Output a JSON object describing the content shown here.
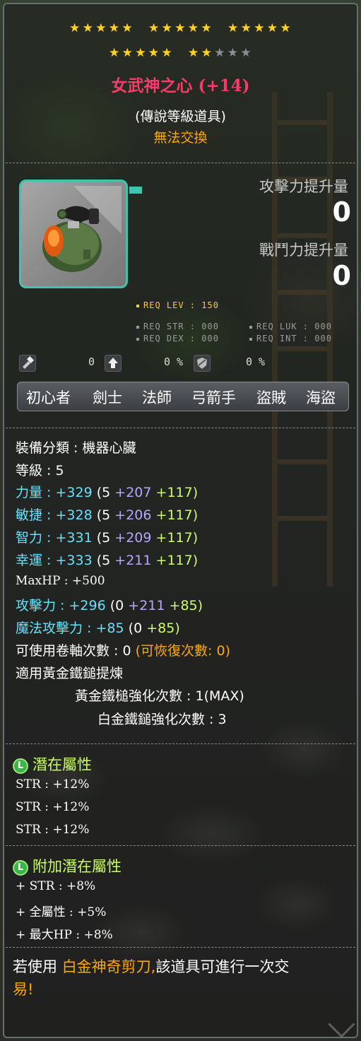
{
  "stars": {
    "top_row_filled": 15,
    "second_row_filled": 7,
    "second_row_total": 10
  },
  "item": {
    "name": "女武神之心 (+14)",
    "grade": "(傳說等級道具)",
    "trade_status": "無法交換"
  },
  "compare": {
    "attack_label": "攻擊力提升量",
    "attack_value": "0",
    "combat_label": "戰鬥力提升量",
    "combat_value": "0"
  },
  "requirements": {
    "level": "REQ LEV : 150",
    "str": "REQ STR : 000",
    "luk": "REQ LUK : 000",
    "dex": "REQ DEX : 000",
    "int": "REQ INT : 000"
  },
  "mini_stats": [
    {
      "icon": "hammer-icon",
      "value": "0"
    },
    {
      "icon": "upgrade-icon",
      "value": "0 %"
    },
    {
      "icon": "shield-icon",
      "value": "0 %"
    }
  ],
  "jobs": [
    "初心者",
    "劍士",
    "法師",
    "弓箭手",
    "盜賊",
    "海盜"
  ],
  "details": {
    "category": "裝備分類 : 機器心臟",
    "level": "等級 : 5",
    "stats": [
      {
        "label": "力量 :",
        "total": "+329",
        "base": "(5",
        "bonus": "+207",
        "star": "+117)"
      },
      {
        "label": "敏捷 :",
        "total": "+328",
        "base": "(5",
        "bonus": "+206",
        "star": "+117)"
      },
      {
        "label": "智力 :",
        "total": "+331",
        "base": "(5",
        "bonus": "+209",
        "star": "+117)"
      },
      {
        "label": "幸運 :",
        "total": "+333",
        "base": "(5",
        "bonus": "+211",
        "star": "+117)"
      }
    ],
    "maxhp": "MaxHP : +500",
    "attack": {
      "label": "攻擊力 :",
      "total": "+296",
      "base": "(0",
      "bonus": "+211",
      "star": "+85)"
    },
    "magic": {
      "label": "魔法攻擊力 :",
      "total": "+85",
      "base": "(0",
      "star": "+85)"
    },
    "scroll_slots": "可使用卷軸次數 : 0",
    "recoverable": "(可恢復次數: 0)",
    "golden_hammer": "適用黃金鐵鎚提煉",
    "golden_count": "黃金鐵槌強化次數 : 1(MAX)",
    "platinum_count": "白金鐵鎚強化次數 : 3"
  },
  "potential": {
    "title": "潛在屬性",
    "badge": "L",
    "lines": [
      "STR : +12%",
      "STR : +12%",
      "STR : +12%"
    ]
  },
  "bonus_potential": {
    "title": "附加潛在屬性",
    "badge": "L",
    "lines": [
      "+ STR : +8%",
      "+ 全屬性 : +5%",
      "+ 最大HP : +8%"
    ]
  },
  "footer": {
    "prefix": "若使用",
    "highlight": "白金神奇剪刀,",
    "suffix": "該道具可進行一次交",
    "end": "易!"
  },
  "colors": {
    "title": "#ff3a6a",
    "untradeable": "#ffa800",
    "stat_label": "#64e1ff",
    "bonus": "#b6a6ff",
    "starforce": "#ccff66",
    "frame": "#3fc4b0"
  }
}
